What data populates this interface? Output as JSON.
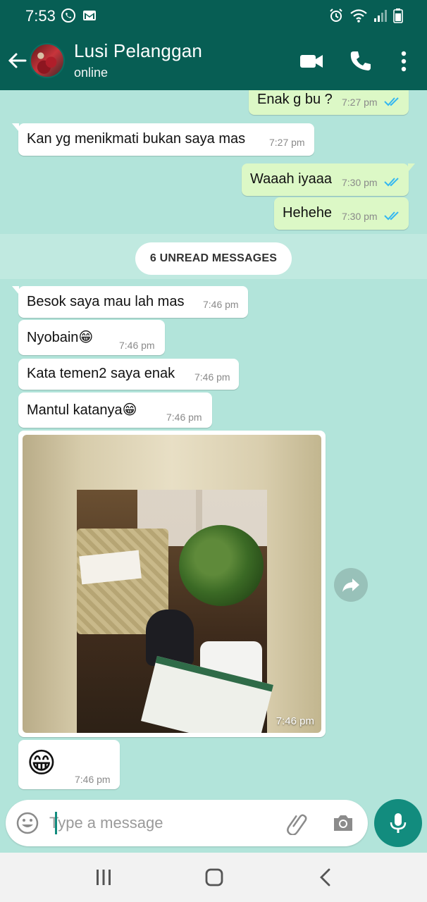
{
  "status_bar": {
    "time": "7:53"
  },
  "header": {
    "contact_name": "Lusi Pelanggan",
    "contact_status": "online"
  },
  "messages": [
    {
      "dir": "out",
      "text": "Enak g bu ?",
      "time": "7:27 pm"
    },
    {
      "dir": "in",
      "text": "Kan yg menikmati bukan saya mas",
      "time": "7:27 pm"
    },
    {
      "dir": "out",
      "text": "Waaah iyaaa",
      "time": "7:30 pm"
    },
    {
      "dir": "out",
      "text": "Hehehe",
      "time": "7:30 pm"
    },
    {
      "dir": "in",
      "text": "Besok saya mau lah mas",
      "time": "7:46 pm"
    },
    {
      "dir": "in",
      "text": "Nyobain😁",
      "time": "7:46 pm"
    },
    {
      "dir": "in",
      "text": "Kata temen2 saya enak",
      "time": "7:46 pm"
    },
    {
      "dir": "in",
      "text": "Mantul katanya😁",
      "time": "7:46 pm"
    },
    {
      "dir": "in",
      "text": "😁",
      "time": "7:46 pm"
    }
  ],
  "unread_banner": "6 UNREAD MESSAGES",
  "image_message": {
    "time": "7:46 pm"
  },
  "composer": {
    "placeholder": "Type a message"
  },
  "colors": {
    "header": "#075e54",
    "accent": "#128c7e",
    "chat_bg": "#b2e4da",
    "outgoing": "#dcf8c6",
    "read_ticks": "#34b7f1"
  },
  "icons": [
    "back-arrow-icon",
    "video-call-icon",
    "phone-icon",
    "more-options-icon",
    "forward-icon",
    "emoji-icon",
    "attach-icon",
    "camera-icon",
    "mic-icon",
    "recent-apps-icon",
    "home-icon",
    "back-icon"
  ]
}
